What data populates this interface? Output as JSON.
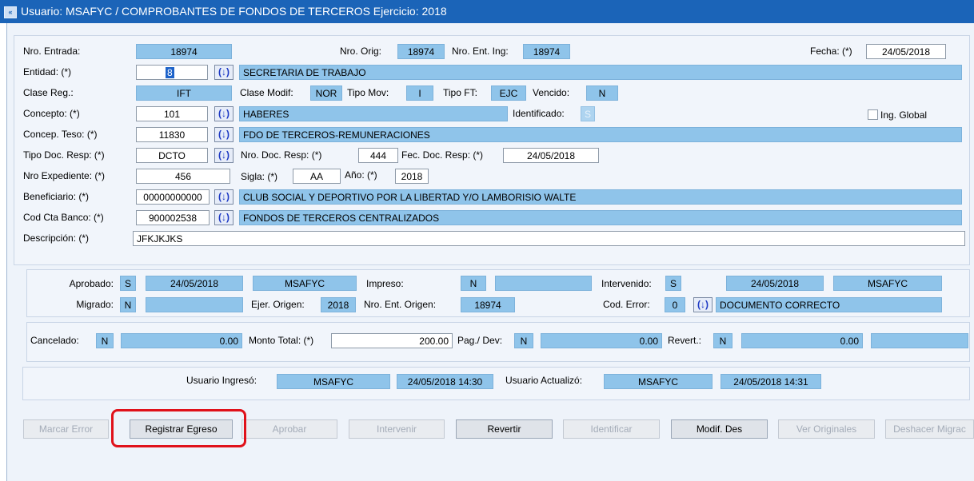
{
  "titlebar": {
    "icon": "window-icon",
    "title": "Usuario: MSAFYC  /  COMPROBANTES DE FONDOS DE TERCEROS  Ejercicio: 2018"
  },
  "header": {
    "nro_entrada_label": "Nro. Entrada:",
    "nro_entrada": "18974",
    "nro_orig_label": "Nro. Orig:",
    "nro_orig": "18974",
    "nro_ent_ing_label": "Nro. Ent. Ing:",
    "nro_ent_ing": "18974",
    "fecha_label": "Fecha: (*)",
    "fecha": "24/05/2018",
    "entidad_label": "Entidad: (*)",
    "entidad_code": "8",
    "entidad_name": "SECRETARIA DE TRABAJO",
    "clase_reg_label": "Clase Reg.:",
    "clase_reg": "IFT",
    "clase_modif_label": "Clase Modif:",
    "clase_modif": "NOR",
    "tipo_mov_label": "Tipo Mov:",
    "tipo_mov": "I",
    "tipo_ft_label": "Tipo FT:",
    "tipo_ft": "EJC",
    "vencido_label": "Vencido:",
    "vencido": "N",
    "concepto_label": "Concepto: (*)",
    "concepto_code": "101",
    "concepto_name": "HABERES",
    "identificado_label": "Identificado:",
    "identificado": "S",
    "ing_global_label": "Ing. Global",
    "concep_teso_label": "Concep. Teso: (*)",
    "concep_teso_code": "11830",
    "concep_teso_name": "FDO DE TERCEROS-REMUNERACIONES",
    "tipo_doc_label": "Tipo Doc. Resp: (*)",
    "tipo_doc": "DCTO",
    "nro_doc_label": "Nro. Doc. Resp: (*)",
    "nro_doc": "444",
    "fec_doc_label": "Fec. Doc. Resp: (*)",
    "fec_doc": "24/05/2018",
    "nro_exp_label": "Nro Expediente: (*)",
    "nro_exp": "456",
    "sigla_label": "Sigla: (*)",
    "sigla": "AA",
    "anio_label": "Año: (*)",
    "anio": "2018",
    "benef_label": "Beneficiario: (*)",
    "benef_code": "00000000000",
    "benef_name": "CLUB SOCIAL Y DEPORTIVO POR LA LIBERTAD Y/O LAMBORISIO WALTE",
    "cta_label": "Cod Cta Banco: (*)",
    "cta_code": "900002538",
    "cta_name": "FONDOS DE TERCEROS CENTRALIZADOS",
    "desc_label": "Descripción: (*)",
    "desc": "JFKJKJKS",
    "lov_glyph": "(↓)"
  },
  "status": {
    "aprobado_label": "Aprobado:",
    "aprobado": "S",
    "aprobado_fecha": "24/05/2018",
    "aprobado_user": "MSAFYC",
    "impreso_label": "Impreso:",
    "impreso": "N",
    "impreso_extra": "",
    "intervenido_label": "Intervenido:",
    "intervenido": "S",
    "intervenido_fecha": "24/05/2018",
    "intervenido_user": "MSAFYC",
    "migrado_label": "Migrado:",
    "migrado": "N",
    "migrado_extra": "",
    "ejer_origen_label": "Ejer. Origen:",
    "ejer_origen": "2018",
    "nro_ent_origen_label": "Nro. Ent. Origen:",
    "nro_ent_origen": "18974",
    "cod_error_label": "Cod. Error:",
    "cod_error": "0",
    "cod_error_desc": "DOCUMENTO CORRECTO"
  },
  "amounts": {
    "cancelado_label": "Cancelado:",
    "cancelado": "N",
    "cancelado_monto": "0.00",
    "monto_total_label": "Monto Total: (*)",
    "monto_total": "200.00",
    "pag_dev_label": "Pag./ Dev:",
    "pag_dev": "N",
    "pag_dev_monto": "0.00",
    "revert_label": "Revert.:",
    "revert": "N",
    "revert_monto": "0.00"
  },
  "audit": {
    "ingreso_label": "Usuario Ingresó:",
    "ingreso_user": "MSAFYC",
    "ingreso_fecha": "24/05/2018 14:30",
    "actualizo_label": "Usuario Actualizó:",
    "actualizo_user": "MSAFYC",
    "actualizo_fecha": "24/05/2018 14:31"
  },
  "buttons": {
    "marcar_error": "Marcar Error",
    "registrar_egreso": "Registrar Egreso",
    "aprobar": "Aprobar",
    "intervenir": "Intervenir",
    "revertir": "Revertir",
    "identificar": "Identificar",
    "modif_des": "Modif. Des",
    "ver_originales": "Ver Originales",
    "deshacer_migracion": "Deshacer Migrac"
  },
  "colors": {
    "titlebar": "#1b64b8",
    "field_blue": "#8fc4ea",
    "highlight": "#e0111a"
  }
}
